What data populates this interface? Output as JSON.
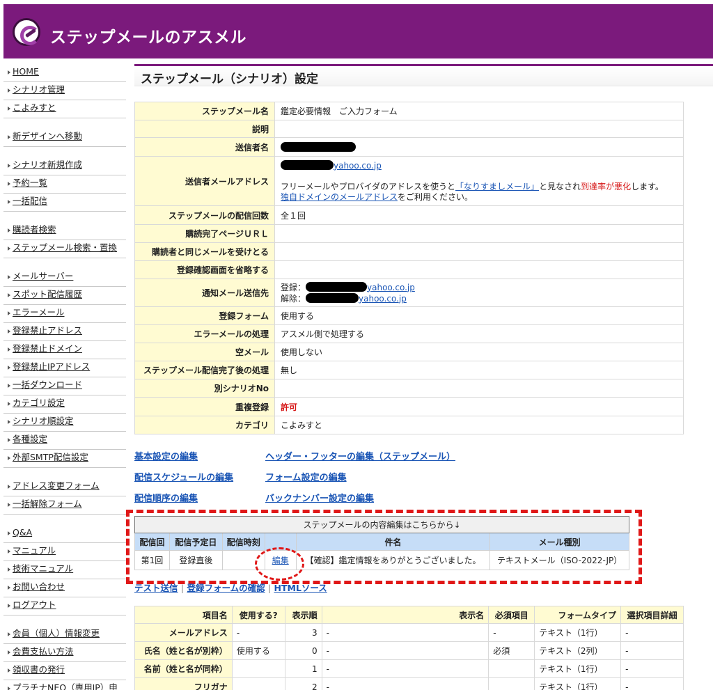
{
  "app": {
    "brand": "ステップメールのアスメル",
    "logo_icon": "asumeru-logo-icon",
    "header_color": "#7b1a7c"
  },
  "sidebar": {
    "groups": [
      [
        "HOME",
        "シナリオ管理",
        "こよみすと"
      ],
      [
        "新デザインへ移動"
      ],
      [
        "シナリオ新規作成",
        "予約一覧",
        "一括配信"
      ],
      [
        "購読者検索",
        "ステップメール検索・置換"
      ],
      [
        "メールサーバー",
        "スポット配信履歴",
        "エラーメール",
        "登録禁止アドレス",
        "登録禁止ドメイン",
        "登録禁止IPアドレス",
        "一括ダウンロード",
        "カテゴリ設定",
        "シナリオ順設定",
        "各種設定",
        "外部SMTP配信設定"
      ],
      [
        "アドレス変更フォーム",
        "一括解除フォーム"
      ],
      [
        "Q&A",
        "マニュアル",
        "技術マニュアル",
        "お問い合わせ",
        "ログアウト"
      ],
      [
        "会員（個人）情報変更",
        "会費支払い方法",
        "領収書の発行",
        "プラチナNEO（専用IP）申"
      ]
    ]
  },
  "page": {
    "title": "ステップメール（シナリオ）設定"
  },
  "settings": {
    "rows": [
      {
        "label": "ステップメール名",
        "value": "鑑定必要情報　ご入力フォーム"
      },
      {
        "label": "説明",
        "value": ""
      },
      {
        "label": "送信者名",
        "value": ""
      },
      {
        "label": "送信者メールアドレス",
        "value": ""
      },
      {
        "label": "ステップメールの配信回数",
        "value": "全１回"
      },
      {
        "label": "購読完了ページＵＲＬ",
        "value": ""
      },
      {
        "label": "購読者と同じメールを受けとる",
        "value": ""
      },
      {
        "label": "登録確認画面を省略する",
        "value": ""
      },
      {
        "label": "通知メール送信先",
        "value": ""
      },
      {
        "label": "登録フォーム",
        "value": "使用する"
      },
      {
        "label": "エラーメールの処理",
        "value": "アスメル側で処理する"
      },
      {
        "label": "空メール",
        "value": "使用しない"
      },
      {
        "label": "ステップメール配信完了後の処理",
        "value": "無し"
      },
      {
        "label": "別シナリオNo",
        "value": ""
      },
      {
        "label": "重複登録",
        "value": "許可"
      },
      {
        "label": "カテゴリ",
        "value": "こよみすと"
      }
    ],
    "sender_email_domain": "yahoo.co.jp",
    "warning_part1": "フリーメールやプロバイダのアドレスを使うと",
    "warning_link": "「なりすましメール」",
    "warning_part2": "と見なされ",
    "warning_red": "到達率が悪化",
    "warning_part3": "します。",
    "own_domain_link": "独自ドメインのメールアドレス",
    "own_domain_suffix": "をご利用ください。",
    "notify_register_label": "登録：",
    "notify_cancel_label": "解除：",
    "notify_domain": "yahoo.co.jp"
  },
  "edit_links": {
    "basic": "基本設定の編集",
    "header_footer": "ヘッダー・フッターの編集（ステップメール）",
    "schedule": "配信スケジュールの編集",
    "form": "フォーム設定の編集",
    "order": "配信順序の編集",
    "backnumber": "バックナンバー設定の編集"
  },
  "content_table": {
    "banner": "ステップメールの内容編集はこちらから↓",
    "headers": [
      "配信回",
      "配信予定日",
      "配信時刻",
      "",
      "件名",
      "メール種別"
    ],
    "rows": [
      {
        "round": "第1回",
        "date": "登録直後",
        "time": "",
        "edit": "編集",
        "subject": "【確認】鑑定情報をありがとうございました。",
        "type": "テキストメール（ISO-2022-JP）"
      }
    ]
  },
  "bottom_links": {
    "test": "テスト送信",
    "confirm": "登録フォームの確認",
    "html": "HTMLソース",
    "sep": "|"
  },
  "form_table": {
    "headers": [
      "項目名",
      "使用する?",
      "表示順",
      "表示名",
      "必須項目",
      "フォームタイプ",
      "選択項目詳細"
    ],
    "rows": [
      {
        "name": "メールアドレス",
        "use": "-",
        "order": "3",
        "display": "-",
        "required": "-",
        "type": "テキスト（1行）",
        "detail": "-"
      },
      {
        "name": "氏名（姓と名が別枠）",
        "use": "使用する",
        "order": "0",
        "display": "-",
        "required": "必須",
        "type": "テキスト（2列）",
        "detail": "-"
      },
      {
        "name": "名前（姓と名が同枠）",
        "use": "",
        "order": "1",
        "display": "-",
        "required": "",
        "type": "テキスト（1行）",
        "detail": "-"
      },
      {
        "name": "フリガナ",
        "use": "",
        "order": "2",
        "display": "-",
        "required": "",
        "type": "テキスト（1行）",
        "detail": "-"
      }
    ]
  }
}
